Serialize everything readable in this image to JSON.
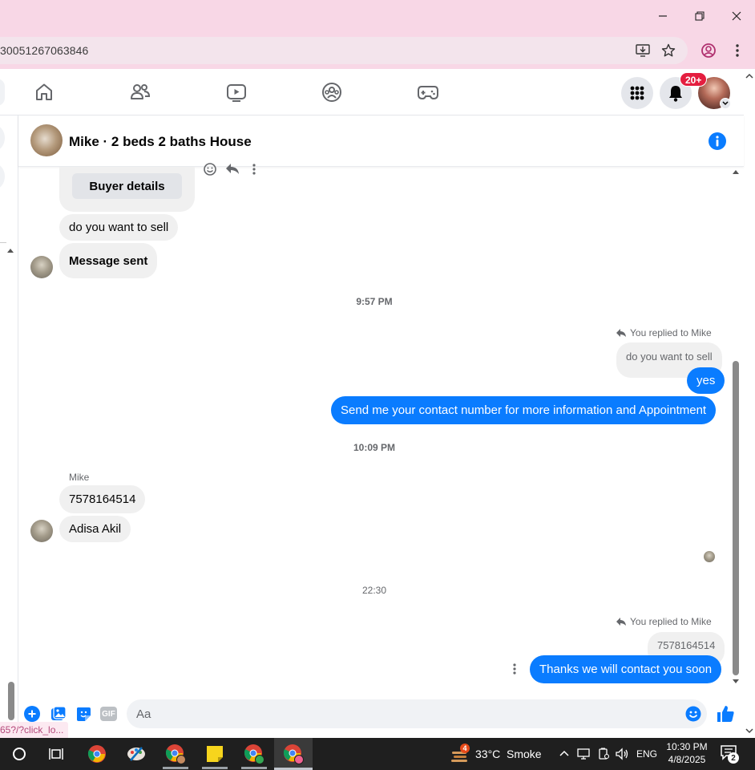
{
  "browser": {
    "url_fragment": "30051267063846",
    "window_controls": {
      "minimize": "minimize-icon",
      "restore": "restore-icon",
      "close": "close-icon"
    }
  },
  "fb_nav": {
    "notification_badge": "20+",
    "icons": [
      "home-icon",
      "friends-icon",
      "watch-icon",
      "groups-icon",
      "gaming-icon"
    ]
  },
  "chat": {
    "title": "Mike · 2 beds 2 baths House",
    "messages": {
      "buyer_details_button": "Buyer details",
      "in_1": "do you want to sell",
      "in_2": "Message sent",
      "time_1": "9:57 PM",
      "replied_label_1": "You replied to Mike",
      "quoted_1": "do you want to sell",
      "out_1": "yes",
      "out_2": "Send me your contact number for more information and Appointment",
      "time_2": "10:09 PM",
      "sender_name": "Mike",
      "in_3": "7578164514",
      "in_4": "Adisa Akil",
      "time_3": "22:30",
      "replied_label_2": "You replied to Mike",
      "quoted_2": "7578164514",
      "out_3": "Thanks we will contact you soon"
    },
    "composer": {
      "placeholder": "Aa"
    }
  },
  "status_link": "65?/?click_lo...",
  "taskbar": {
    "weather_badge": "4",
    "temperature": "33°C",
    "weather": "Smoke",
    "language": "ENG",
    "time": "10:30 PM",
    "date": "4/8/2025",
    "notifications_count": "2"
  },
  "colors": {
    "accent": "#0a7cff",
    "titlebar": "#f8d7e6",
    "badge": "#e41e3f",
    "taskbar": "#1f1f1f"
  }
}
